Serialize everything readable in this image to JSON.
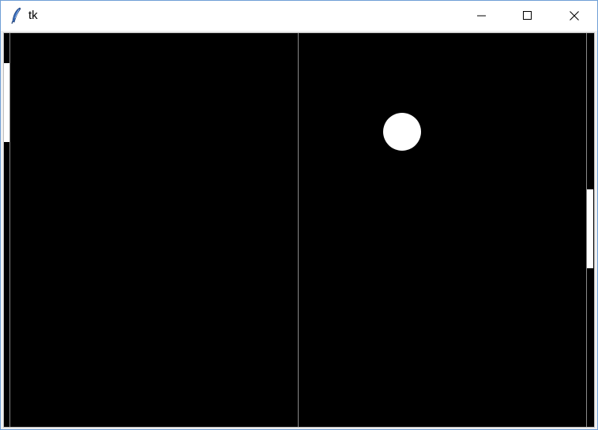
{
  "window": {
    "title": "tk",
    "icon": "tk-feather-icon",
    "controls": [
      "minimize-icon",
      "maximize-icon",
      "close-icon"
    ]
  },
  "canvas": {
    "background": "#000000",
    "line_color": "#8a8a8a",
    "element_color": "#ffffff"
  }
}
